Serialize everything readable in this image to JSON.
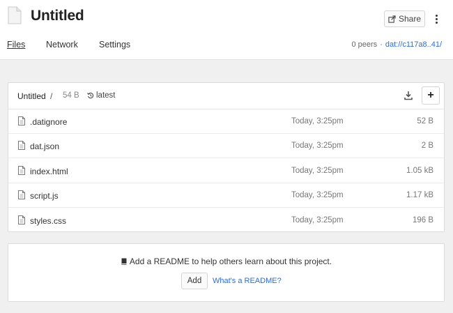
{
  "header": {
    "title": "Untitled",
    "share_label": "Share",
    "tabs": [
      {
        "label": "Files",
        "active": true
      },
      {
        "label": "Network",
        "active": false
      },
      {
        "label": "Settings",
        "active": false
      }
    ],
    "peers": "0 peers",
    "separator": "·",
    "dat_link": "dat://c117a8..41/"
  },
  "breadcrumb": {
    "title": "Untitled",
    "slash": "/",
    "size": "54 B",
    "version": "latest"
  },
  "files": [
    {
      "name": ".datignore",
      "modified": "Today, 3:25pm",
      "size": "52 B"
    },
    {
      "name": "dat.json",
      "modified": "Today, 3:25pm",
      "size": "2 B"
    },
    {
      "name": "index.html",
      "modified": "Today, 3:25pm",
      "size": "1.05 kB"
    },
    {
      "name": "script.js",
      "modified": "Today, 3:25pm",
      "size": "1.17 kB"
    },
    {
      "name": "styles.css",
      "modified": "Today, 3:25pm",
      "size": "196 B"
    }
  ],
  "readme": {
    "message": "Add a README to help others learn about this project.",
    "add_label": "Add",
    "help_link": "What's a README?"
  },
  "icons": {
    "document": "document-icon",
    "share": "share-icon",
    "more": "more-vertical-icon",
    "history": "history-icon",
    "download": "download-icon",
    "add": "plus-icon",
    "file": "file-icon",
    "book": "book-icon"
  },
  "colors": {
    "link": "#2b6fd6",
    "background": "#f0f0f0"
  }
}
